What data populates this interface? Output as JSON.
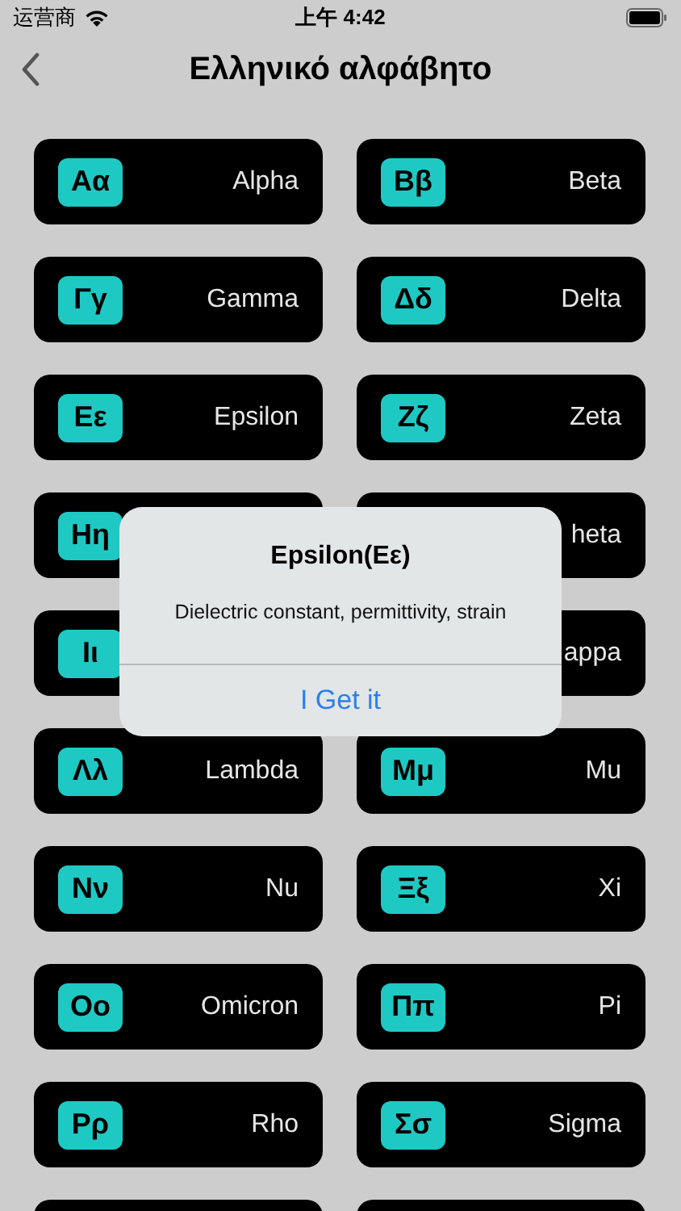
{
  "status_bar": {
    "carrier": "运营商",
    "time": "上午 4:42"
  },
  "nav": {
    "title": "Ελληνικό αλφάβητο"
  },
  "letters": [
    {
      "kind": "letter",
      "symbol": "Αα",
      "name": "Alpha"
    },
    {
      "kind": "letter",
      "symbol": "Ββ",
      "name": "Beta"
    },
    {
      "kind": "letter",
      "symbol": "Γγ",
      "name": "Gamma"
    },
    {
      "kind": "letter",
      "symbol": "Δδ",
      "name": "Delta"
    },
    {
      "kind": "letter",
      "symbol": "Εε",
      "name": "Epsilon"
    },
    {
      "kind": "letter",
      "symbol": "Ζζ",
      "name": "Zeta"
    },
    {
      "kind": "letter",
      "symbol": "Ηη"
    },
    {
      "kind": "letter",
      "name": "heta"
    },
    {
      "kind": "letter",
      "symbol": "Ιι"
    },
    {
      "kind": "letter",
      "name": "appa"
    },
    {
      "kind": "letter",
      "symbol": "Λλ",
      "name": "Lambda"
    },
    {
      "kind": "letter",
      "symbol": "Μμ",
      "name": "Mu"
    },
    {
      "kind": "letter",
      "symbol": "Νν",
      "name": "Nu"
    },
    {
      "kind": "letter",
      "symbol": "Ξξ",
      "name": "Xi"
    },
    {
      "kind": "letter",
      "symbol": "Οο",
      "name": "Omicron"
    },
    {
      "kind": "letter",
      "symbol": "Ππ",
      "name": "Pi"
    },
    {
      "kind": "letter",
      "symbol": "Ρρ",
      "name": "Rho"
    },
    {
      "kind": "letter",
      "symbol": "Σσ",
      "name": "Sigma"
    },
    {
      "kind": "blank"
    },
    {
      "kind": "blank"
    }
  ],
  "alert": {
    "title": "Epsilon(Εε)",
    "message": "Dielectric constant, permittivity, strain",
    "button": "I Get it"
  }
}
